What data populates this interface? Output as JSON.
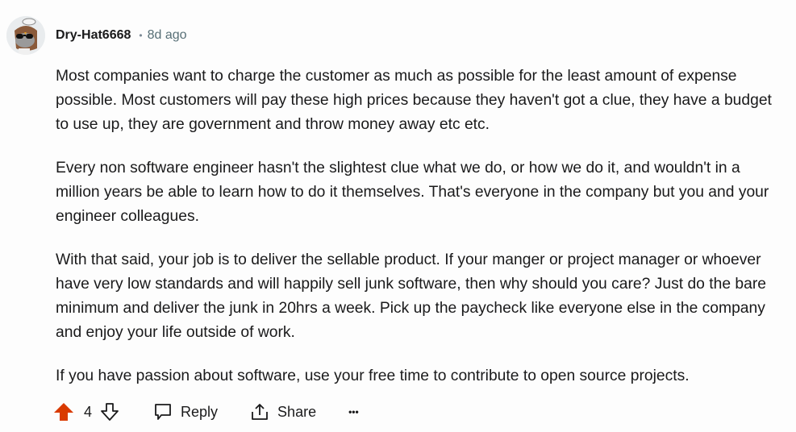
{
  "comment": {
    "author": "Dry-Hat6668",
    "separator": "•",
    "time": "8d ago",
    "paragraphs": [
      "Most companies want to charge the customer as much as possible for the least amount of expense possible. Most customers will pay these high prices because they haven't got a clue, they have a budget to use up, they are government and throw money away etc etc.",
      "Every non software engineer hasn't the slightest clue what we do, or how we do it, and wouldn't in a million years be able to learn how to do it themselves. That's everyone in the company but you and your engineer colleagues.",
      "With that said, your job is to deliver the sellable product. If your manger or project manager or whoever have very low standards and will happily sell junk software, then why should you care? Just do the bare minimum and deliver the junk in 20hrs a week. Pick up the paycheck like everyone else in the company and enjoy your life outside of work.",
      "If you have passion about software, use your free time to contribute to open source projects."
    ]
  },
  "actions": {
    "vote_count": "4",
    "reply_label": "Reply",
    "share_label": "Share",
    "more_label": "•••",
    "upvote_color": "#d93a00"
  }
}
